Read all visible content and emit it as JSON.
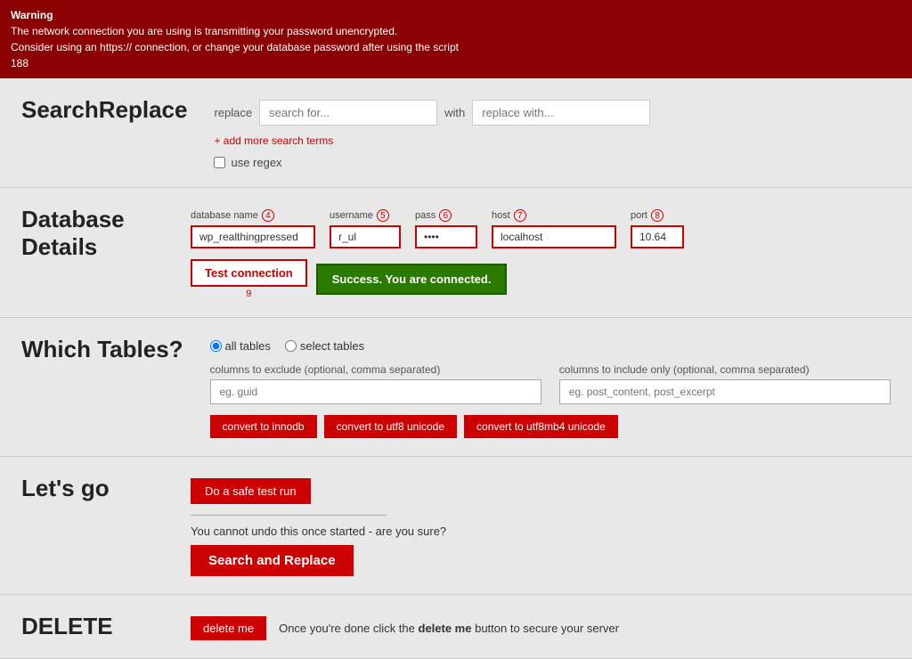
{
  "warning": {
    "title": "Warning",
    "line1": "The network connection you are using is transmitting your password unencrypted.",
    "line2": "Consider using an https:// connection, or change your database password after using the script",
    "line3": "188"
  },
  "app": {
    "title_bold": "Search",
    "title_light": "Replace"
  },
  "search_replace": {
    "replace_label": "replace",
    "search_placeholder": "search for...",
    "with_label": "with",
    "replace_placeholder": "replace with...",
    "add_more_label": "+ add more search terms",
    "use_regex_label": "use regex"
  },
  "database": {
    "section_title": "Database\nDetails",
    "db_name_label": "database name",
    "db_name_num": "4",
    "db_name_value": "wp_realthingpressed",
    "username_label": "username",
    "username_num": "5",
    "username_value": "r_ul",
    "pass_label": "pass",
    "pass_num": "6",
    "pass_value": "••••",
    "host_label": "host",
    "host_num": "7",
    "host_value": "localhost",
    "port_label": "port",
    "port_num": "8",
    "port_value": "10.64",
    "test_btn": "Test connection",
    "test_num": "9",
    "success_msg": "Success. You are connected."
  },
  "tables": {
    "section_title": "Which Tables?",
    "all_tables_label": "all tables",
    "select_tables_label": "select tables",
    "exclude_label": "columns to exclude (optional, comma separated)",
    "exclude_placeholder": "eg. guid",
    "include_label": "columns to include only (optional, comma separated)",
    "include_placeholder": "eg. post_content, post_excerpt",
    "btn_innodb": "convert to innodb",
    "btn_utf8": "convert to utf8 unicode",
    "btn_utf8mb4": "convert to utf8mb4 unicode"
  },
  "letsgo": {
    "section_title": "Let's go",
    "safe_run_btn": "Do a safe test run",
    "warning_text": "You cannot undo this once started - are you sure?",
    "search_replace_btn": "Search and Replace"
  },
  "delete": {
    "section_title": "DELETE",
    "delete_btn": "delete me",
    "delete_text_before": "Once you're done click the ",
    "delete_text_bold": "delete me",
    "delete_text_after": " button to secure your server"
  }
}
